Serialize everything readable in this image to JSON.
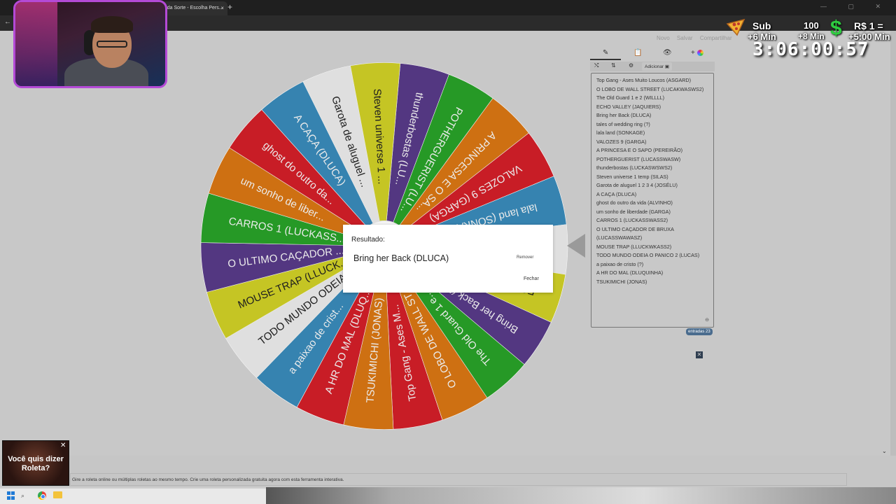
{
  "browser": {
    "tab_title": "ta da Sorte - Escolha Pers...",
    "tab_close": "×",
    "new_tab": "+",
    "back": "←",
    "window_controls": "— ▢ ✕"
  },
  "site_nav": [
    "Novo",
    "Salvar",
    "Compartilhar"
  ],
  "wheel": {
    "segments": [
      {
        "label": "thunderbostas (LU...",
        "color": "#5b3c8c"
      },
      {
        "label": "POTHERGUERIST (LU...",
        "color": "#2aa62a"
      },
      {
        "label": "A PRINCESA E O SA...",
        "color": "#e07a14"
      },
      {
        "label": "VALOZES 9 (GARGA)",
        "color": "#d9202a"
      },
      {
        "label": "lala land (SONKAG...",
        "color": "#3b8fbf"
      },
      {
        "label": "tales of wedding ...",
        "color": "#f2f2f2"
      },
      {
        "label": "ECHO VALLEY (JA...",
        "color": "#d6d628"
      },
      {
        "label": "Bring her Back (D...",
        "color": "#5b3c8c"
      },
      {
        "label": "The Old Guard 1 e...",
        "color": "#2aa62a"
      },
      {
        "label": "O LOBO DE WALL ST...",
        "color": "#e07a14"
      },
      {
        "label": "Top Gang - Ases M...",
        "color": "#d9202a"
      },
      {
        "label": "TSUKIMICHI (JONAS)",
        "color": "#e07a14"
      },
      {
        "label": "A HR DO MAL (DLUQ...",
        "color": "#d9202a"
      },
      {
        "label": "a paixao de crist...",
        "color": "#3b8fbf"
      },
      {
        "label": "TODO MUNDO ODEIA ...",
        "color": "#f2f2f2"
      },
      {
        "label": "MOUSE TRAP (LLUCK...",
        "color": "#d6d628"
      },
      {
        "label": "O ULTIMO CAÇADOR ...",
        "color": "#5b3c8c"
      },
      {
        "label": "CARROS 1 (LUCKASS...",
        "color": "#2aa62a"
      },
      {
        "label": "um sonho de liber...",
        "color": "#e07a14"
      },
      {
        "label": "ghost do outro da...",
        "color": "#d9202a"
      },
      {
        "label": "A CAÇA (DLUCA)",
        "color": "#3b8fbf"
      },
      {
        "label": "Garota de aluguel ...",
        "color": "#f2f2f2"
      },
      {
        "label": "Steven universe 1 ...",
        "color": "#d6d628"
      }
    ]
  },
  "panel": {
    "tabs": {
      "edit": "✎",
      "clipboard": "📋",
      "hide": "👁",
      "colors": "+"
    },
    "toolbar": {
      "shuffle": "⤭",
      "sort": "⇅",
      "settings": "⚙",
      "add": "Adicionar ▣"
    },
    "entries": [
      "Top Gang - Ases Muito Loucos (ASGARD)",
      "O LOBO DE WALL STREET (LUCAKWASWS2)",
      "The Old Guard 1 e 2 (WILLLL)",
      "ECHO VALLEY (JAQUIERS)",
      "Bring her Back (DLUCA)",
      "tales of wedding ring (?)",
      "lala land (SONKAGE)",
      "VALOZES 9 (GARGA)",
      "A PRINCESA E O SAPO (PEREIRÃO)",
      "POTHERGUERIST (LUCASSWASW)",
      "thunderbostas (LUCKASWSWS2)",
      "Steven universe 1 temp (SILAS)",
      "Garota de aluguel 1 2 3 4 (JOSÉLU)",
      "A CAÇA (DLUCA)",
      "ghost do outro da vida (ALVINHO)",
      "um sonho de liberdade (GARGA)",
      "CARROS 1 (LUCKASSWASS2)",
      "O ULTIMO CAÇADOR DE BRUXA",
      "(LUCASSWAWASZ)",
      "MOUSE TRAP (LLUCKWKASS2)",
      "TODO MUNDO ODEIA O PANICO 2 (LUCAS)",
      "a paixao de cristo (?)",
      "A HR DO MAL (DLUQUINHA)",
      "TSUKIMICHI (JONAS)"
    ],
    "resize_icon": "⊖",
    "count_badge": "entradas 23",
    "small_close": "✕"
  },
  "modal": {
    "title": "Resultado:",
    "result": "Bring her Back (DLUCA)",
    "remove": "Remover",
    "close": "Fechar"
  },
  "footer": {
    "text": "Gire a roleta online ou múltiplas roletas ao mesmo tempo. Crie uma roleta personalizada gratuita agora com esta ferramenta interativa."
  },
  "ad": {
    "text_line1": "Você quis dizer",
    "text_line2": "Roleta?",
    "close": "✕"
  },
  "overlay": {
    "sub_label": "Sub",
    "sub_bonus": "+6 Min",
    "hundred_label": "100",
    "hundred_bonus": "+8 Min",
    "money_label": "R$ 1 =",
    "money_bonus": "+5:00 Min",
    "timer": "3:06:00:57"
  }
}
